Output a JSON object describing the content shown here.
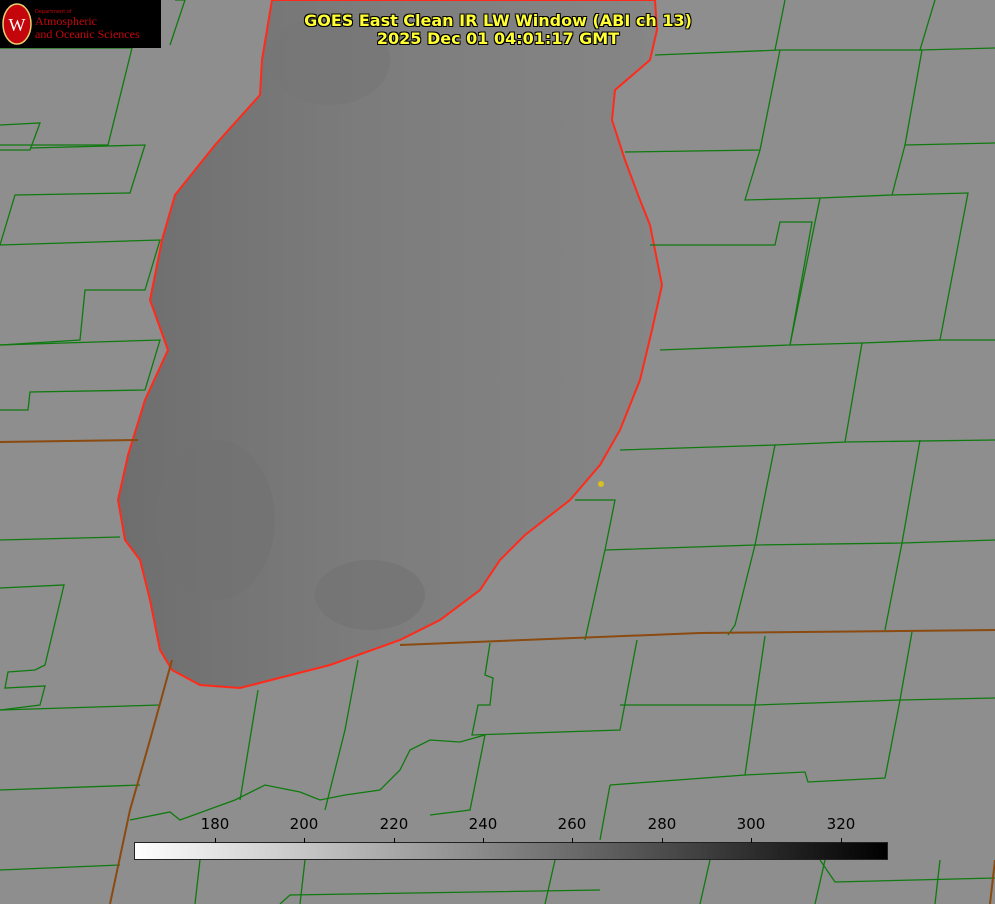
{
  "title": {
    "line1": "GOES East Clean IR LW Window (ABI ch 13)",
    "line2": "2025 Dec 01 04:01:17 GMT"
  },
  "logo": {
    "dept": "Department of",
    "line1": "Atmospheric",
    "line2": "and Oceanic Sciences",
    "letter": "W"
  },
  "colorbar": {
    "ticks": [
      "180",
      "200",
      "220",
      "240",
      "260",
      "280",
      "300",
      "320"
    ]
  },
  "colors": {
    "lake_outline": "#ff2a1a",
    "county_lines": "#0f7a0f",
    "state_lines": "#8a4a10",
    "title_text": "#ffff33",
    "marker": "#d8c020"
  }
}
